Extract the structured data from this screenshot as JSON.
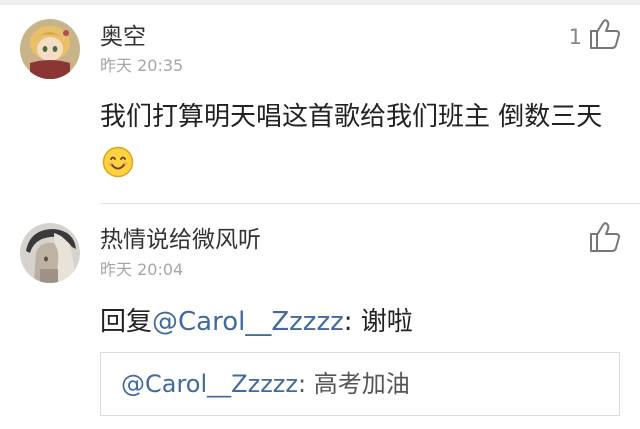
{
  "comments": [
    {
      "username": "奥空",
      "timestamp": "昨天 20:35",
      "likes": "1",
      "text": "我们打算明天唱这首歌给我们班主  倒数三天",
      "emoji": "smiling-face-emoji",
      "avatar": "avatar-anime-character"
    },
    {
      "username": "热情说给微风听",
      "timestamp": "昨天 20:04",
      "likes": "",
      "reply_prefix": "回复",
      "mention": "@Carol__Zzzzz",
      "reply_text": ": 谢啦",
      "avatar": "avatar-anime-character-grey",
      "quoted": {
        "mention": "@Carol__Zzzzz",
        "text": ": 高考加油"
      }
    }
  ],
  "icons": {
    "like": "thumbs-up-icon"
  },
  "colors": {
    "mention": "#3f6b9e",
    "timestamp": "#a6a6a6",
    "text": "#222222"
  }
}
